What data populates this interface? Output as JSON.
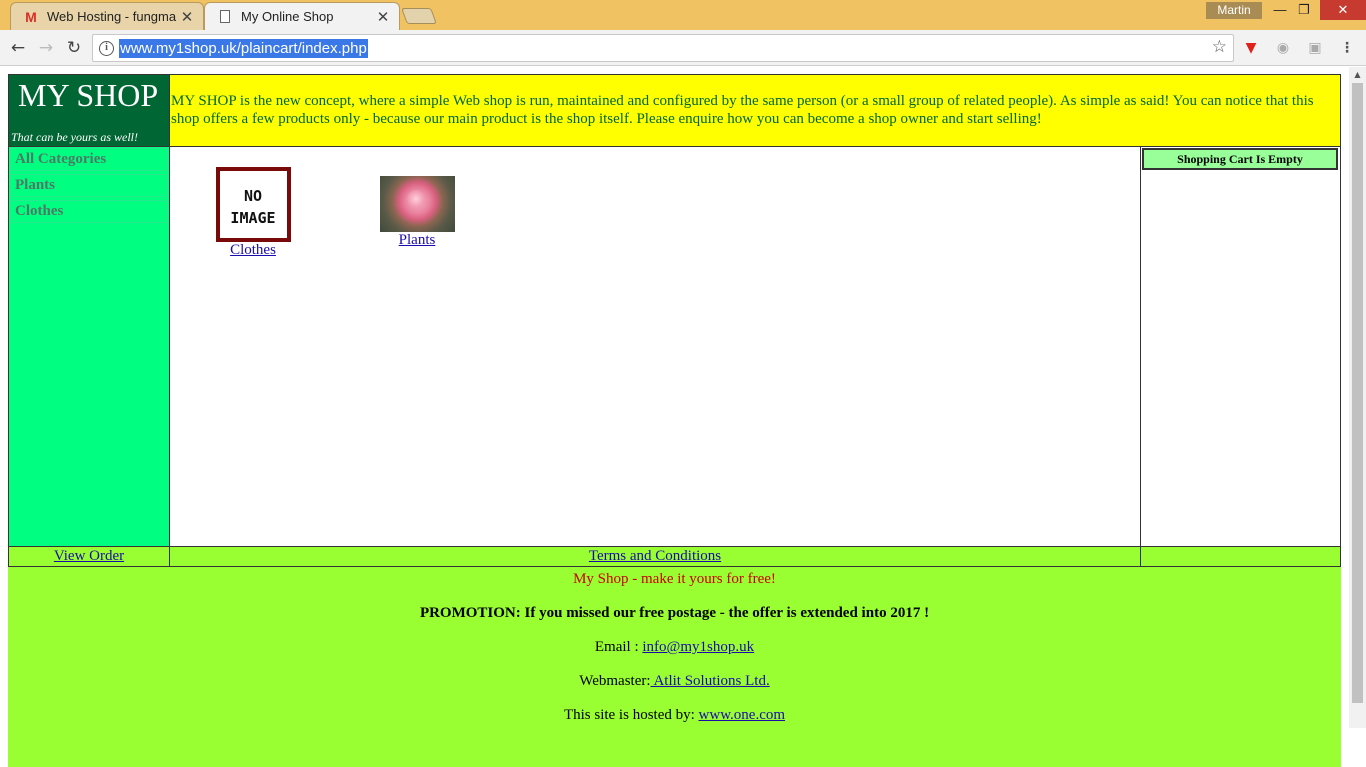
{
  "browser": {
    "tabs": [
      {
        "title": "Web Hosting - fungma",
        "icon": "gmail-icon",
        "active": false
      },
      {
        "title": "My Online Shop",
        "icon": "document-icon",
        "active": true
      }
    ],
    "user_name": "Martin",
    "address": "www.my1shop.uk/plaincart/index.php"
  },
  "shop": {
    "brand_name": "MY SHOP",
    "tagline": "That can be yours as well!",
    "intro": "MY SHOP is the new concept, where a simple Web shop is run, maintained and configured by the same person (or a small group of related people). As simple as said! You can notice that this shop offers a few products only - because our main product is the shop itself. Please enquire how you can become a shop owner and start selling!",
    "categories": [
      "All Categories",
      "Plants",
      "Clothes"
    ],
    "products": [
      {
        "label": "Clothes",
        "image_text": "NO IMAGE"
      },
      {
        "label": "Plants"
      }
    ],
    "cart_status": "Shopping Cart Is Empty",
    "view_order": "View Order",
    "terms": "Terms and Conditions"
  },
  "footer": {
    "slogan": "My Shop - make it yours for free!",
    "promotion": "PROMOTION: If you missed our free postage - the offer is extended into 2017 !",
    "email_label": "Email :",
    "email": "info@my1shop.uk",
    "webmaster_label": "Webmaster:",
    "webmaster": " Atlit Solutions Ltd.",
    "hosted_label": "This site is hosted by:",
    "host": "www.one.com"
  }
}
